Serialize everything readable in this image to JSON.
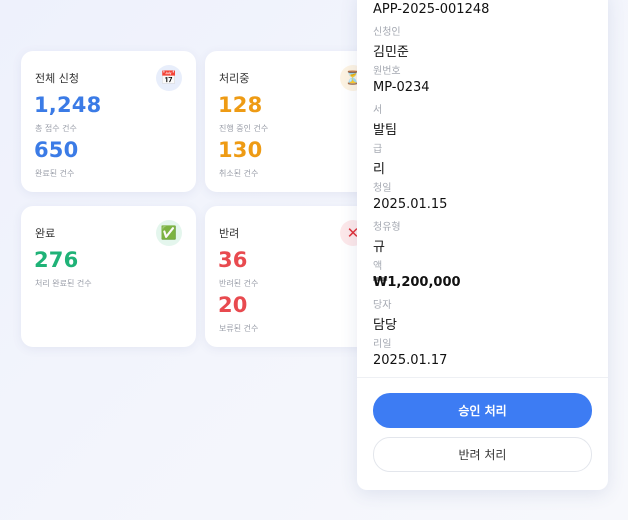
{
  "cards": {
    "total": {
      "title": "전체 신청",
      "icon": "📅",
      "value1": "1,248",
      "label1": "총 접수 건수",
      "value2": "650",
      "label2": "완료된 건수"
    },
    "processing": {
      "title": "처리중",
      "icon": "⏳",
      "value1": "128",
      "label1": "진행 중인 건수",
      "value2": "130",
      "label2": "취소된 건수"
    },
    "done": {
      "title": "완료",
      "icon": "✅",
      "value1": "276",
      "label1": "처리 완료된 건수"
    },
    "rejected": {
      "title": "반려",
      "icon": "✕",
      "value1": "36",
      "label1": "반려된 건수",
      "value2": "20",
      "label2": "보류된 건수"
    }
  },
  "detail": {
    "app_id": "APP-2025-001248",
    "fields": [
      {
        "label": "신청인",
        "value": "김민준"
      },
      {
        "label": "원번호",
        "value": "MP-0234"
      },
      {
        "label": "서",
        "value": "발팀"
      },
      {
        "label": "급",
        "value": "리"
      },
      {
        "label": "청일",
        "value": "2025.01.15"
      },
      {
        "label": "청유형",
        "value": "규"
      },
      {
        "label": "액",
        "value": "₩1,200,000"
      },
      {
        "label": "당자",
        "value": "담당"
      },
      {
        "label": "리일",
        "value": "2025.01.17"
      }
    ],
    "approve_label": "승인 처리",
    "reject_label": "반려 처리"
  },
  "colors": {
    "blue": "#3b7be6",
    "orange": "#ee9b14",
    "green": "#1fb277",
    "red": "#e84a4f",
    "primary_button": "#3d7cf3"
  }
}
